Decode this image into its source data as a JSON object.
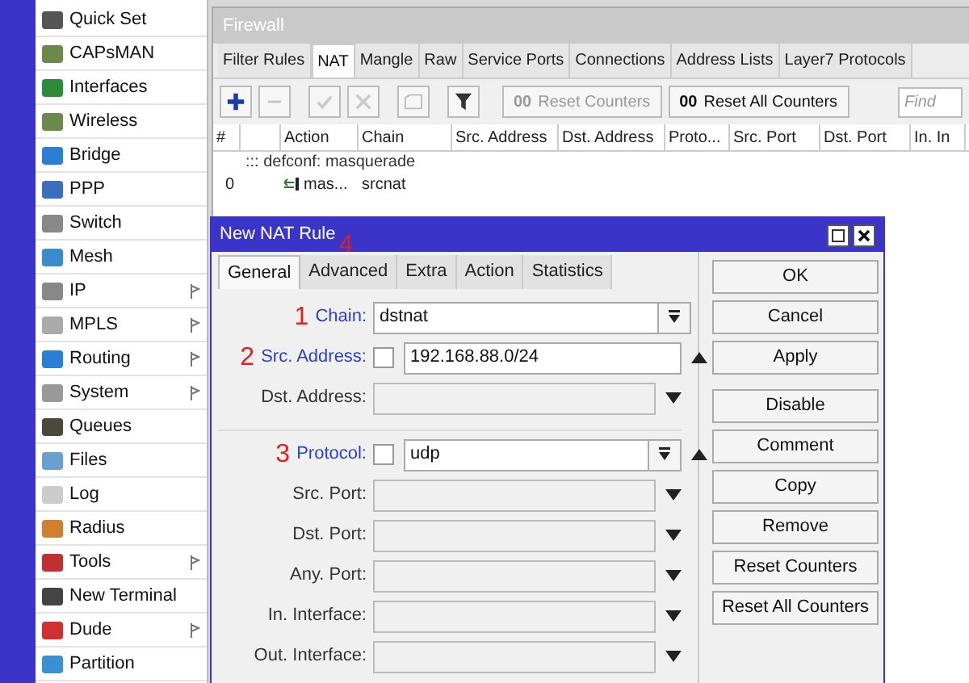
{
  "sidebar": {
    "items": [
      {
        "label": "Quick Set",
        "submenu": false,
        "color": "#555555"
      },
      {
        "label": "CAPsMAN",
        "submenu": false,
        "color": "#6a8a4a"
      },
      {
        "label": "Interfaces",
        "submenu": false,
        "color": "#2e8b3a"
      },
      {
        "label": "Wireless",
        "submenu": false,
        "color": "#6a8a4a"
      },
      {
        "label": "Bridge",
        "submenu": false,
        "color": "#2a7fd4"
      },
      {
        "label": "PPP",
        "submenu": false,
        "color": "#3a6fc0"
      },
      {
        "label": "Switch",
        "submenu": false,
        "color": "#888888"
      },
      {
        "label": "Mesh",
        "submenu": false,
        "color": "#3a8ad0"
      },
      {
        "label": "IP",
        "submenu": true,
        "color": "#888888"
      },
      {
        "label": "MPLS",
        "submenu": true,
        "color": "#aaaaaa"
      },
      {
        "label": "Routing",
        "submenu": true,
        "color": "#2a7fd4"
      },
      {
        "label": "System",
        "submenu": true,
        "color": "#999999"
      },
      {
        "label": "Queues",
        "submenu": false,
        "color": "#4a4a3a"
      },
      {
        "label": "Files",
        "submenu": false,
        "color": "#6aa0d0"
      },
      {
        "label": "Log",
        "submenu": false,
        "color": "#cccccc"
      },
      {
        "label": "Radius",
        "submenu": false,
        "color": "#d08030"
      },
      {
        "label": "Tools",
        "submenu": true,
        "color": "#c03030"
      },
      {
        "label": "New Terminal",
        "submenu": false,
        "color": "#444444"
      },
      {
        "label": "Dude",
        "submenu": true,
        "color": "#d03030"
      },
      {
        "label": "Partition",
        "submenu": false,
        "color": "#3a90d0"
      }
    ]
  },
  "firewall": {
    "title": "Firewall",
    "tabs": [
      {
        "label": "Filter Rules",
        "selected": false
      },
      {
        "label": "NAT",
        "selected": true
      },
      {
        "label": "Mangle",
        "selected": false
      },
      {
        "label": "Raw",
        "selected": false
      },
      {
        "label": "Service Ports",
        "selected": false
      },
      {
        "label": "Connections",
        "selected": false
      },
      {
        "label": "Address Lists",
        "selected": false
      },
      {
        "label": "Layer7 Protocols",
        "selected": false
      }
    ],
    "toolbar": {
      "reset_counters": {
        "icon_text": "00",
        "label": "Reset Counters",
        "disabled": true
      },
      "reset_all_counters": {
        "icon_text": "00",
        "label": "Reset All Counters",
        "disabled": false
      },
      "find": {
        "placeholder": "Find"
      }
    },
    "table": {
      "columns": [
        "#",
        "Action",
        "Chain",
        "Src. Address",
        "Dst. Address",
        "Proto...",
        "Src. Port",
        "Dst. Port",
        "In. In"
      ],
      "rows": [
        {
          "kind": "comment",
          "text": "::: defconf: masquerade"
        },
        {
          "kind": "rule",
          "number": "0",
          "action": "mas...",
          "chain": "srcnat"
        }
      ]
    }
  },
  "dialog": {
    "title": "New NAT Rule",
    "tabs": [
      {
        "label": "General",
        "selected": true
      },
      {
        "label": "Advanced",
        "selected": false,
        "marker": "4"
      },
      {
        "label": "Extra",
        "selected": false
      },
      {
        "label": "Action",
        "selected": false
      },
      {
        "label": "Statistics",
        "selected": false
      }
    ],
    "fields": [
      {
        "kind": "select",
        "label": "Chain:",
        "marker": "1",
        "set": true,
        "value": "dstnat"
      },
      {
        "kind": "condition",
        "label": "Src. Address:",
        "marker": "2",
        "set": true,
        "value": "192.168.88.0/24",
        "expanded": true,
        "negated": false,
        "dropdown": false
      },
      {
        "kind": "condition",
        "label": "Dst. Address:",
        "set": false,
        "expanded": false
      },
      {
        "kind": "separator"
      },
      {
        "kind": "condition",
        "label": "Protocol:",
        "marker": "3",
        "set": true,
        "value": "udp",
        "expanded": true,
        "negated": false,
        "dropdown": true
      },
      {
        "kind": "condition",
        "label": "Src. Port:",
        "set": false,
        "expanded": false
      },
      {
        "kind": "condition",
        "label": "Dst. Port:",
        "set": false,
        "expanded": false
      },
      {
        "kind": "condition",
        "label": "Any. Port:",
        "set": false,
        "expanded": false
      },
      {
        "kind": "condition",
        "label": "In. Interface:",
        "set": false,
        "expanded": false
      },
      {
        "kind": "condition",
        "label": "Out. Interface:",
        "set": false,
        "expanded": false
      }
    ],
    "button_groups": [
      [
        "OK",
        "Cancel",
        "Apply"
      ],
      [
        "Disable",
        "Comment",
        "Copy",
        "Remove",
        "Reset Counters",
        "Reset All Counters"
      ]
    ]
  }
}
